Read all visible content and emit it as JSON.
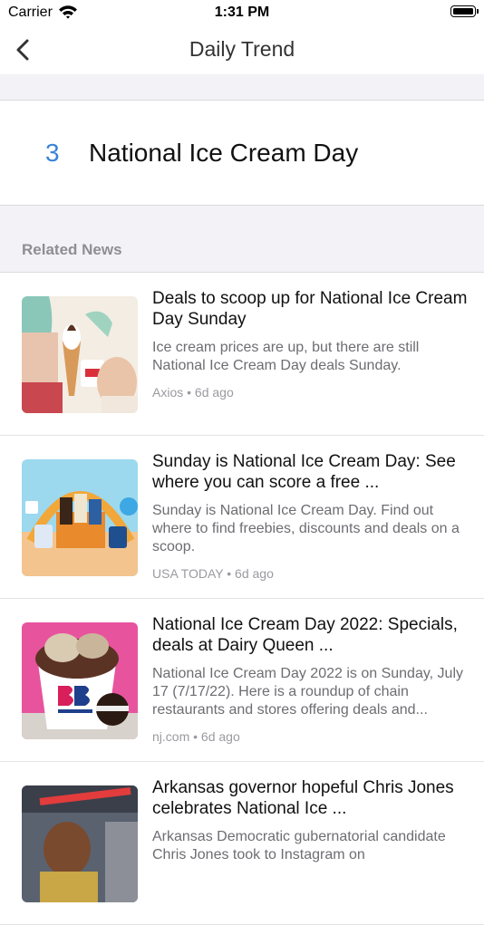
{
  "status_bar": {
    "carrier": "Carrier",
    "time": "1:31 PM"
  },
  "nav": {
    "title": "Daily Trend"
  },
  "trend": {
    "rank": "3",
    "title": "National Ice Cream Day"
  },
  "related": {
    "label": "Related News"
  },
  "news": [
    {
      "title": "Deals to scoop up for National Ice Cream Day Sunday",
      "summary": "Ice cream prices are up, but there are still National Ice Cream Day deals Sunday.",
      "source": "Axios",
      "time": "6d ago"
    },
    {
      "title": "Sunday is National Ice Cream Day: See where you can score a free ...",
      "summary": "Sunday is National Ice Cream Day. Find out where to find freebies, discounts and deals on a scoop.",
      "source": "USA TODAY",
      "time": "6d ago"
    },
    {
      "title": "National Ice Cream Day 2022: Specials, deals at Dairy Queen ...",
      "summary": "National Ice Cream Day 2022 is on Sunday, July 17 (7/17/22). Here is a roundup of chain restaurants and stores offering deals and...",
      "source": "nj.com",
      "time": "6d ago"
    },
    {
      "title": "Arkansas governor hopeful Chris Jones celebrates National Ice ...",
      "summary": "Arkansas Democratic gubernatorial candidate Chris Jones took to Instagram on",
      "source": "",
      "time": ""
    }
  ],
  "meta_separator": "•",
  "colors": {
    "accent": "#3b82d6",
    "grouped_background": "#f2f2f7"
  },
  "icons": {
    "back": "chevron-left-icon",
    "wifi": "wifi-icon",
    "battery": "battery-icon"
  }
}
